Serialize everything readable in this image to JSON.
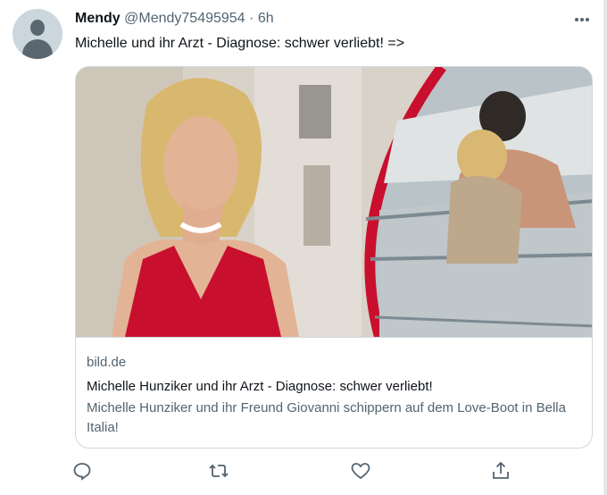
{
  "tweet": {
    "author_name": "Mendy",
    "author_handle": "@Mendy75495954",
    "separator": "·",
    "time": "6h",
    "text": "Michelle und ihr Arzt - Diagnose: schwer verliebt! =>"
  },
  "card": {
    "domain": "bild.de",
    "title": "Michelle Hunziker und ihr Arzt - Diagnose: schwer verliebt!",
    "description": "Michelle Hunziker und ihr Freund Giovanni schippern auf dem Love-Boot in Bella Italia!"
  },
  "icons": {
    "more": "more-horizontal-icon",
    "reply": "reply-icon",
    "retweet": "retweet-icon",
    "like": "heart-icon",
    "share": "share-icon"
  },
  "colors": {
    "primary_text": "#0f1419",
    "secondary_text": "#536471",
    "border": "#cfd9de",
    "accent_red": "#c8102e"
  }
}
